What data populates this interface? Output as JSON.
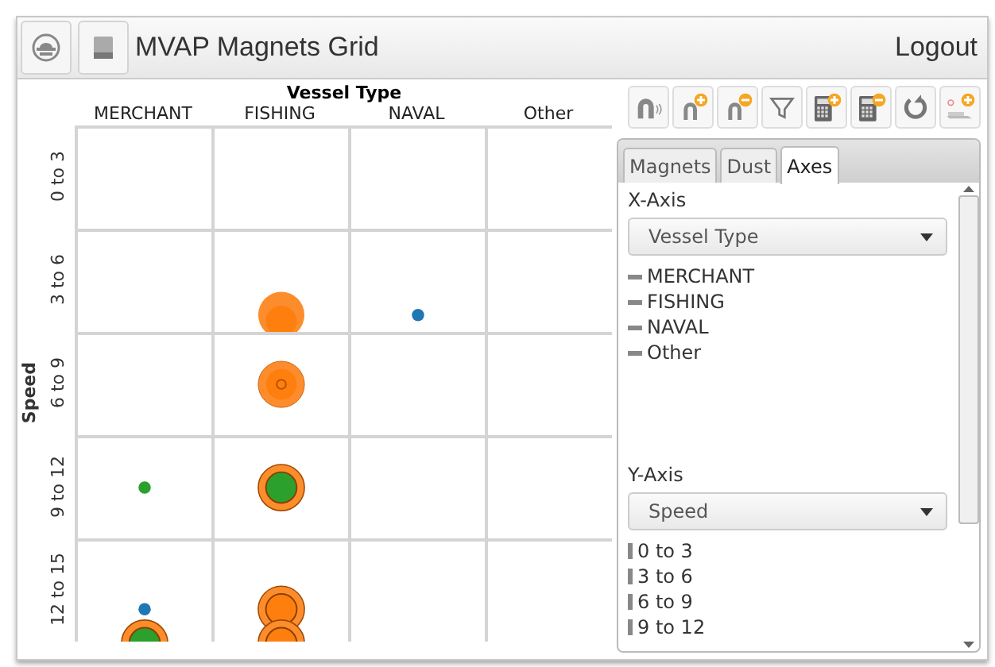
{
  "window": {
    "title": "MVAP Magnets Grid",
    "logout": "Logout"
  },
  "grid": {
    "x_title": "Vessel Type",
    "y_title": "Speed",
    "columns": [
      "MERCHANT",
      "FISHING",
      "NAVAL",
      "Other"
    ],
    "rows": [
      {
        "label": "0 to 3",
        "cells": [
          [],
          [],
          [],
          []
        ]
      },
      {
        "label": "3 to 6",
        "cells": [
          [],
          [
            {
              "kind": "bubble",
              "color": "#ff7f0e"
            }
          ],
          [
            {
              "kind": "bottom-dot",
              "color": "#1f77b4"
            }
          ],
          []
        ]
      },
      {
        "label": "6 to 9",
        "cells": [
          [],
          [
            {
              "kind": "target",
              "color": "#ff7f0e"
            }
          ],
          [],
          []
        ]
      },
      {
        "label": "9 to 12",
        "cells": [
          [
            {
              "kind": "dot",
              "color": "#2ca02c"
            }
          ],
          [
            {
              "kind": "ring",
              "color": "#2ca02c"
            }
          ],
          [],
          []
        ]
      },
      {
        "label": "12 to 15",
        "cells": [
          [
            {
              "kind": "low-dot",
              "color": "#1f77b4"
            },
            {
              "kind": "edge-ring",
              "color": "#2ca02c"
            }
          ],
          [
            {
              "kind": "low-ring",
              "color": "#ff7f0e"
            },
            {
              "kind": "edge-ring",
              "color": "#ff7f0e"
            }
          ],
          [],
          []
        ]
      }
    ]
  },
  "toolbar": [
    {
      "kind": "magnet"
    },
    {
      "kind": "magnet-add"
    },
    {
      "kind": "magnet-remove"
    },
    {
      "kind": "filter"
    },
    {
      "kind": "calc-add"
    },
    {
      "kind": "calc-remove"
    },
    {
      "kind": "reset"
    },
    {
      "kind": "add-layer"
    }
  ],
  "tabs": [
    {
      "label": "Magnets",
      "selected": false
    },
    {
      "label": "Dust",
      "selected": false
    },
    {
      "label": "Axes",
      "selected": true
    }
  ],
  "axes": [
    {
      "title": "X-Axis",
      "value": "Vessel Type",
      "kind": "horizontal",
      "items": [
        "MERCHANT",
        "FISHING",
        "NAVAL",
        "Other"
      ]
    },
    {
      "title": "Y-Axis",
      "value": "Speed",
      "kind": "vertical",
      "items": [
        "0 to 3",
        "3 to 6",
        "6 to 9",
        "9 to 12"
      ]
    }
  ]
}
